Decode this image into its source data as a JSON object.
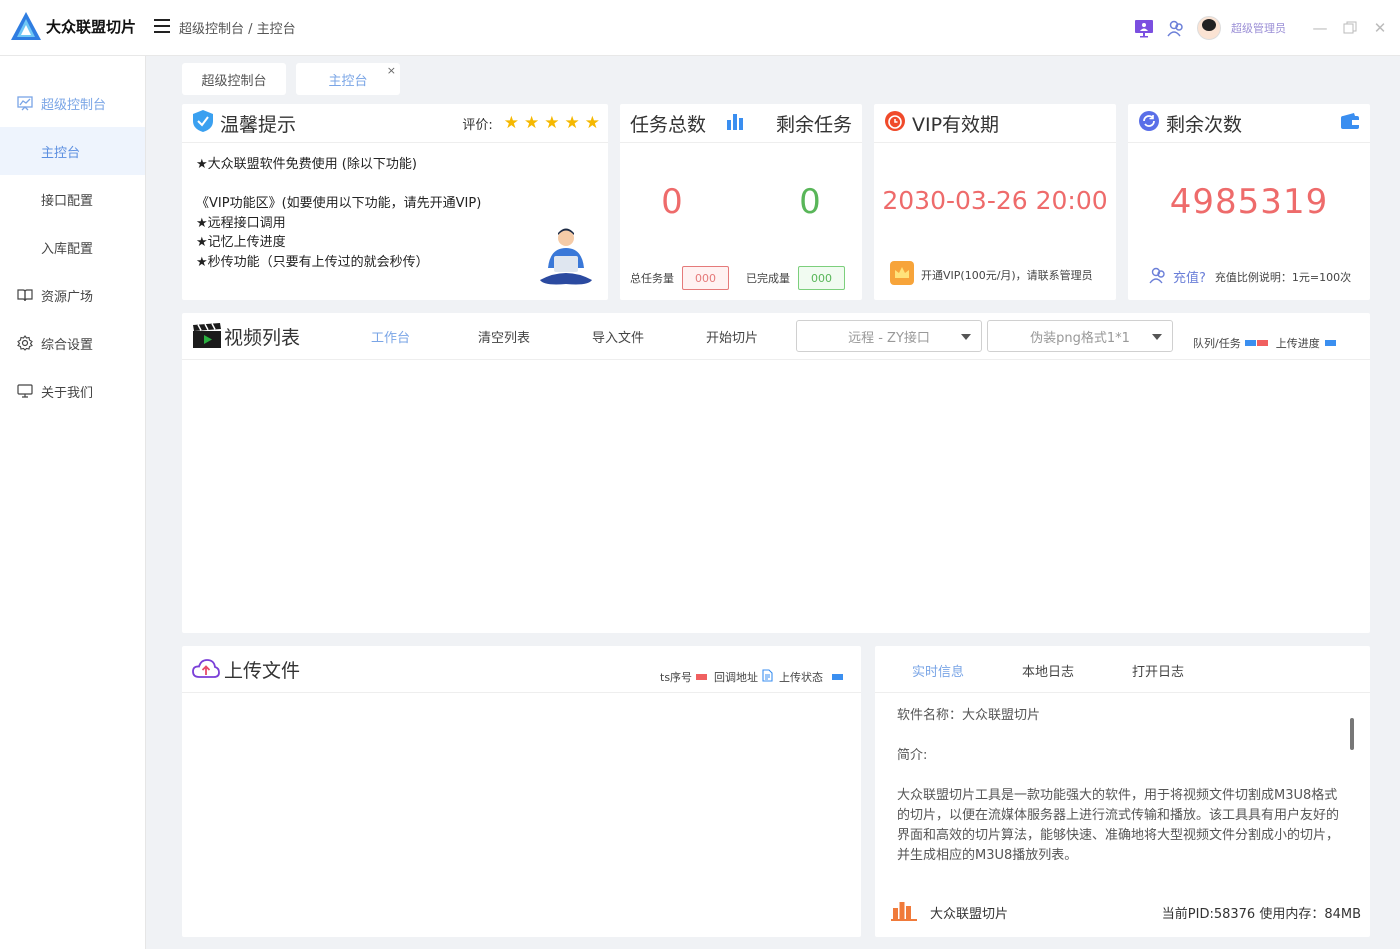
{
  "app": {
    "name": "大众联盟切片"
  },
  "breadcrumb": "超级控制台  / 主控台",
  "header": {
    "admin_name": "超级管理员"
  },
  "sidebar": {
    "items": [
      {
        "label": "超级控制台",
        "icon": "dashboard-icon"
      },
      {
        "label": "主控台"
      },
      {
        "label": "接口配置"
      },
      {
        "label": "入库配置"
      },
      {
        "label": "资源广场",
        "icon": "book-icon"
      },
      {
        "label": "综合设置",
        "icon": "gear-icon"
      },
      {
        "label": "关于我们",
        "icon": "monitor-icon"
      }
    ]
  },
  "tabs": [
    {
      "label": "超级控制台"
    },
    {
      "label": "主控台",
      "close": "×"
    }
  ],
  "notice": {
    "title": "温馨提示",
    "rating_label": "评价:",
    "rating": 5,
    "lines": [
      "★大众联盟软件免费使用 (除以下功能)",
      "",
      "《VIP功能区》(如要使用以下功能，请先开通VIP)",
      "★远程接口调用",
      "★记忆上传进度",
      "★秒传功能（只要有上传过的就会秒传）"
    ]
  },
  "tasks": {
    "title_total": "任务总数",
    "title_remaining": "剩余任务",
    "total": "0",
    "remaining": "0",
    "total_label": "总任务量",
    "total_box": "000",
    "done_label": "已完成量",
    "done_box": "000"
  },
  "vip": {
    "title": "VIP有效期",
    "expiry": "2030-03-26 20:00",
    "note": "开通VIP(100元/月)，请联系管理员"
  },
  "remaining_count": {
    "title": "剩余次数",
    "value": "4985319",
    "recharge": "充值?",
    "ratio": "充值比例说明：1元=100次"
  },
  "video": {
    "title": "视频列表",
    "tabs": [
      "工作台",
      "清空列表",
      "导入文件",
      "开始切片"
    ],
    "select_interface": "远程 - ZY接口",
    "select_format": "伪装png格式1*1",
    "legend_queue": "队列/任务",
    "legend_progress": "上传进度"
  },
  "upload": {
    "title": "上传文件",
    "legend_ts": "ts序号",
    "legend_callback": "回调地址",
    "legend_status": "上传状态"
  },
  "log": {
    "tabs": [
      "实时信息",
      "本地日志",
      "打开日志"
    ],
    "software_name": "软件名称：大众联盟切片",
    "intro_label": "简介:",
    "intro_text": "大众联盟切片工具是一款功能强大的软件，用于将视频文件切割成M3U8格式的切片，以便在流媒体服务器上进行流式传输和播放。该工具具有用户友好的界面和高效的切片算法，能够快速、准确地将大型视频文件分割成小的切片，并生成相应的M3U8播放列表。",
    "footer_name": "大众联盟切片",
    "footer_status": "当前PID:58376 使用内存：84MB"
  },
  "colors": {
    "accent": "#7aa5e6",
    "red": "#ee6b6b",
    "green": "#59b659",
    "blue_legend": "#3b8ff0",
    "red_legend": "#f06060"
  }
}
